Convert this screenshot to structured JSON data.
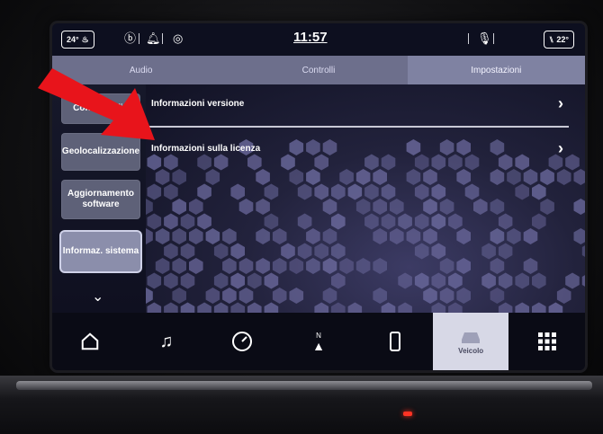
{
  "status_bar": {
    "left_temp": "24°",
    "clock": "11:57",
    "right_temp": "22°"
  },
  "tabs": [
    {
      "label": "Audio"
    },
    {
      "label": "Controlli"
    },
    {
      "label": "Impostazioni"
    }
  ],
  "sidebar": {
    "items": [
      {
        "label": "Config. radio"
      },
      {
        "label": "Geolocalizzazione"
      },
      {
        "label": "Aggiornamento software"
      },
      {
        "label": "Informaz. sistema"
      }
    ]
  },
  "list": {
    "rows": [
      {
        "label": "Informazioni versione"
      },
      {
        "label": "Informazioni sulla licenza"
      }
    ]
  },
  "bottom_nav": {
    "items": [
      {
        "icon": "home-icon"
      },
      {
        "icon": "music-note-icon"
      },
      {
        "icon": "gauge-icon"
      },
      {
        "icon": "navigation-icon"
      },
      {
        "icon": "phone-icon"
      },
      {
        "icon": "vehicle-icon",
        "label": "Veicolo"
      },
      {
        "icon": "grid-apps-icon"
      }
    ]
  },
  "colors": {
    "accent": "#d7d8e6",
    "annotation_arrow": "#e8141b"
  }
}
